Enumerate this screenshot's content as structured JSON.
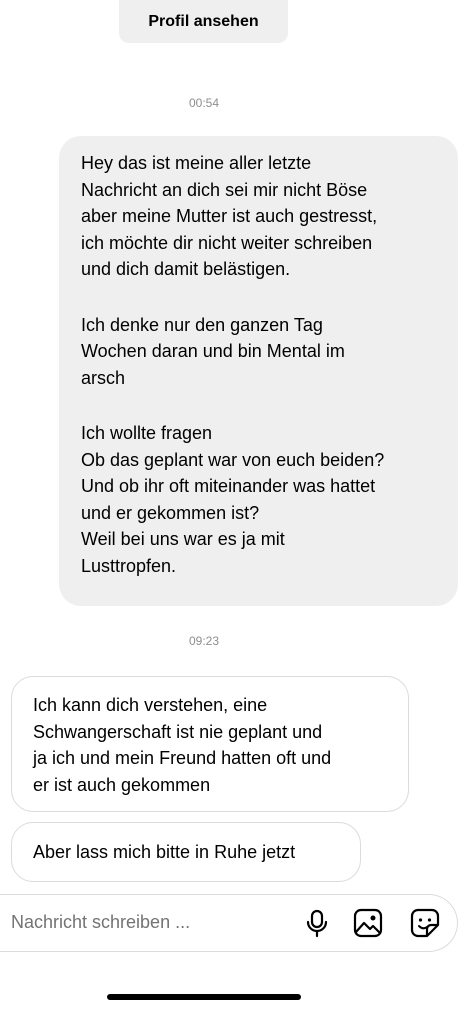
{
  "header": {
    "profile_button_label": "Profil ansehen"
  },
  "thread": {
    "timestamp_1": "00:54",
    "outgoing_message": {
      "block_1": "Hey das ist meine aller letzte\nNachricht an dich sei mir nicht Böse\naber meine Mutter ist auch gestresst,\nich möchte dir nicht weiter schreiben\nund dich damit belästigen.",
      "block_2": "Ich denke nur den ganzen Tag\nWochen daran und bin Mental im\narsch",
      "block_3": "Ich wollte fragen\nOb das geplant war von euch beiden?\nUnd ob ihr oft miteinander was hattet\nund er gekommen ist?\nWeil bei uns war es ja mit\nLusttropfen."
    },
    "timestamp_2": "09:23",
    "incoming_message_1": "Ich kann dich verstehen, eine\nSchwangerschaft ist nie geplant und\nja ich und mein Freund hatten oft und\ner ist auch gekommen",
    "incoming_message_2": "Aber lass mich bitte in Ruhe jetzt"
  },
  "composer": {
    "placeholder": "Nachricht schreiben ...",
    "icons": [
      "microphone-icon",
      "gallery-icon",
      "sticker-icon"
    ]
  },
  "colors": {
    "outgoing_bubble": "#efefef",
    "incoming_border": "#dbdbdb",
    "timestamp": "#8e8e8e",
    "placeholder": "#737373"
  }
}
